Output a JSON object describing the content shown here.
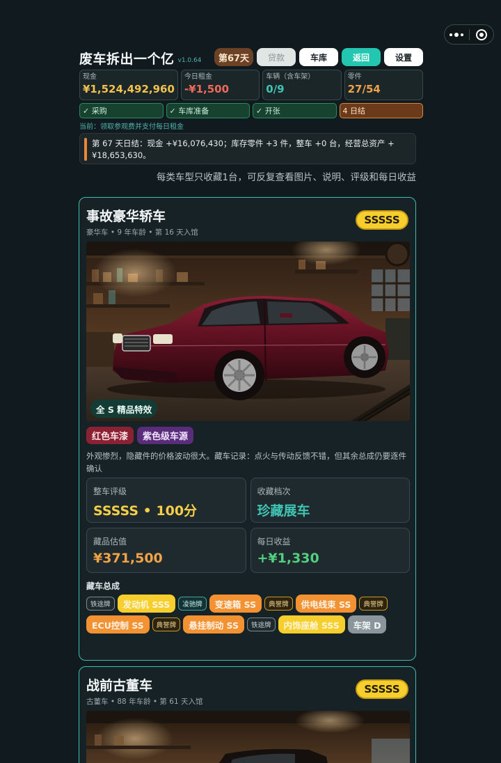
{
  "header": {
    "title": "废车拆出一个亿",
    "version": "v1.0.64",
    "day_badge": "第67天",
    "buttons": {
      "loan": "贷款",
      "garage": "车库",
      "back": "返回",
      "settings": "设置"
    }
  },
  "stats": [
    {
      "label": "现金",
      "value": "¥1,524,492,960"
    },
    {
      "label": "今日租金",
      "value": "-¥1,500"
    },
    {
      "label": "车辆（含车架）",
      "value": "0/9"
    },
    {
      "label": "零件",
      "value": "27/54"
    }
  ],
  "phases": [
    "✓ 采购",
    "✓ 车库准备",
    "✓ 开张",
    "4 日结"
  ],
  "current_step": "当前：领取参观费并支付每日租金",
  "daily_log": "第 67 天日结：现金 +¥16,076,430；库存零件 +3 件，整车 +0 台，经营总资产 +¥18,653,630。",
  "hint": "每类车型只收藏1台，可反复查看图片、说明、评级和每日收益",
  "cars": [
    {
      "title": "事故豪华轿车",
      "subtitle": "豪华车 • 9 年车龄 • 第 16 天入馆",
      "grade": "SSSSS",
      "fx_badge": "全 S 精品特效",
      "tags": [
        "红色车漆",
        "紫色级车源"
      ],
      "description": "外观惨烈，隐藏件的价格波动很大。藏车记录：点火与传动反馈不错，但其余总成仍要逐件确认",
      "metrics": {
        "rating_label": "整车评级",
        "rating_value": "SSSSS • 100分",
        "tier_label": "收藏档次",
        "tier_value": "珍藏展车",
        "value_label": "藏品估值",
        "value_value": "¥371,500",
        "income_label": "每日收益",
        "income_value": "+¥1,330"
      },
      "parts_title": "藏车总成",
      "parts": [
        {
          "brand": "铁途牌",
          "brand_style": "grey",
          "name": "发动机 SSS",
          "grade_style": "sss"
        },
        {
          "brand": "凌驰牌",
          "brand_style": "teal",
          "name": "变速箱 SS",
          "grade_style": "ss"
        },
        {
          "brand": "典誉牌",
          "brand_style": "gold",
          "name": "供电线束 SS",
          "grade_style": "ss"
        },
        {
          "brand": "典誉牌",
          "brand_style": "gold",
          "name": "ECU控制 SS",
          "grade_style": "ss"
        },
        {
          "brand": "典誉牌",
          "brand_style": "gold",
          "name": "悬挂制动 SS",
          "grade_style": "ss"
        },
        {
          "brand": "铁途牌",
          "brand_style": "grey",
          "name": "内饰座舱 SSS",
          "grade_style": "sss"
        },
        {
          "brand": "",
          "brand_style": "",
          "name": "车架 D",
          "grade_style": "d"
        }
      ]
    },
    {
      "title": "战前古董车",
      "subtitle": "古董车 • 88 年车龄 • 第 61 天入馆",
      "grade": "SSSSS"
    }
  ],
  "colors": {
    "background": "#111b1f",
    "accent_teal": "#22c6b1",
    "cash_gold": "#f2c14e",
    "negative_red": "#f06a5a",
    "grade_yellow": "#f6cf2f",
    "part_orange": "#f39232"
  },
  "icons": [
    "more-dots-icon",
    "target-close-icon"
  ]
}
